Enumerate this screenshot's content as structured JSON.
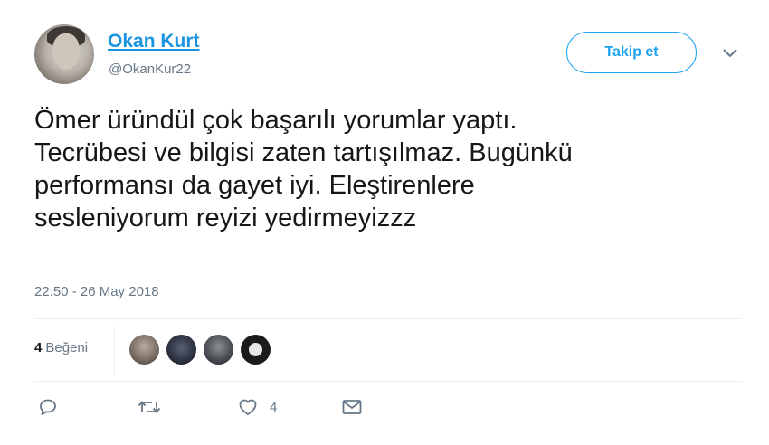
{
  "user": {
    "name": "Okan Kurt",
    "handle": "@OkanKur22"
  },
  "follow_button": {
    "label": "Takip et"
  },
  "tweet": {
    "lines": [
      "Ömer üründül çok başarılı yorumlar yaptı.",
      "Tecrübesi ve bilgisi zaten tartışılmaz. Bugünkü",
      "performansı da gayet iyi. Eleştirenlere",
      "sesleniyorum reyizi yedirmeyizzz"
    ],
    "timestamp": "22:50 - 26 May 2018"
  },
  "stats": {
    "likes_count": "4",
    "likes_label": "Beğeni"
  },
  "actions": {
    "like_count": "4"
  },
  "icons": {
    "caret": "chevron-down-icon",
    "reply": "reply-icon",
    "retweet": "retweet-icon",
    "like": "heart-icon",
    "message": "envelope-icon"
  },
  "colors": {
    "accent": "#1da1f2",
    "name": "#1b95e0",
    "muted": "#657786",
    "text": "#14171a"
  }
}
